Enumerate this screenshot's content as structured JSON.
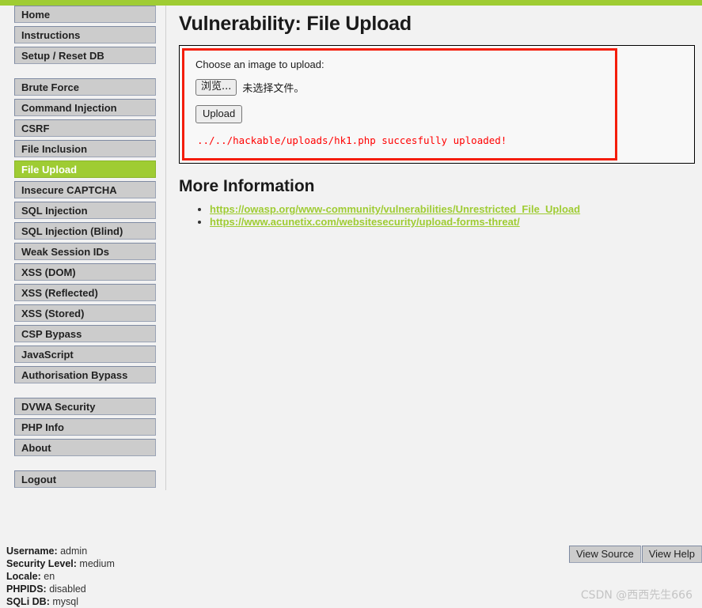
{
  "theme": {
    "accent_green": "#9FCC33",
    "alert_red": "#FF0000",
    "panel_border_red": "#F41D0A",
    "menu_gray": "#CCCCCC",
    "page_background": "#F2F2F2"
  },
  "sidebar": {
    "groups": [
      {
        "items": [
          {
            "label": "Home",
            "selected": false
          },
          {
            "label": "Instructions",
            "selected": false
          },
          {
            "label": "Setup / Reset DB",
            "selected": false
          }
        ]
      },
      {
        "items": [
          {
            "label": "Brute Force",
            "selected": false
          },
          {
            "label": "Command Injection",
            "selected": false
          },
          {
            "label": "CSRF",
            "selected": false
          },
          {
            "label": "File Inclusion",
            "selected": false
          },
          {
            "label": "File Upload",
            "selected": true
          },
          {
            "label": "Insecure CAPTCHA",
            "selected": false
          },
          {
            "label": "SQL Injection",
            "selected": false
          },
          {
            "label": "SQL Injection (Blind)",
            "selected": false
          },
          {
            "label": "Weak Session IDs",
            "selected": false
          },
          {
            "label": "XSS (DOM)",
            "selected": false
          },
          {
            "label": "XSS (Reflected)",
            "selected": false
          },
          {
            "label": "XSS (Stored)",
            "selected": false
          },
          {
            "label": "CSP Bypass",
            "selected": false
          },
          {
            "label": "JavaScript",
            "selected": false
          },
          {
            "label": "Authorisation Bypass",
            "selected": false
          }
        ]
      },
      {
        "items": [
          {
            "label": "DVWA Security",
            "selected": false
          },
          {
            "label": "PHP Info",
            "selected": false
          },
          {
            "label": "About",
            "selected": false
          }
        ]
      },
      {
        "items": [
          {
            "label": "Logout",
            "selected": false
          }
        ]
      }
    ]
  },
  "main": {
    "page_title": "Vulnerability: File Upload",
    "upload_form": {
      "choose_label": "Choose an image to upload:",
      "browse_button_label": "浏览...",
      "file_status_text": "未选择文件。",
      "upload_button_label": "Upload",
      "result_message": "../../hackable/uploads/hk1.php succesfully uploaded!"
    },
    "more_information": {
      "heading": "More Information",
      "links": [
        "https://owasp.org/www-community/vulnerabilities/Unrestricted_File_Upload",
        "https://www.acunetix.com/websitesecurity/upload-forms-threat/"
      ]
    }
  },
  "footer": {
    "status": {
      "username_label": "Username:",
      "username_value": "admin",
      "security_level_label": "Security Level:",
      "security_level_value": "medium",
      "locale_label": "Locale:",
      "locale_value": "en",
      "phpids_label": "PHPIDS:",
      "phpids_value": "disabled",
      "sqli_db_label": "SQLi DB:",
      "sqli_db_value": "mysql"
    },
    "buttons": {
      "view_source": "View Source",
      "view_help": "View Help"
    },
    "watermark": "CSDN @西西先生666"
  }
}
